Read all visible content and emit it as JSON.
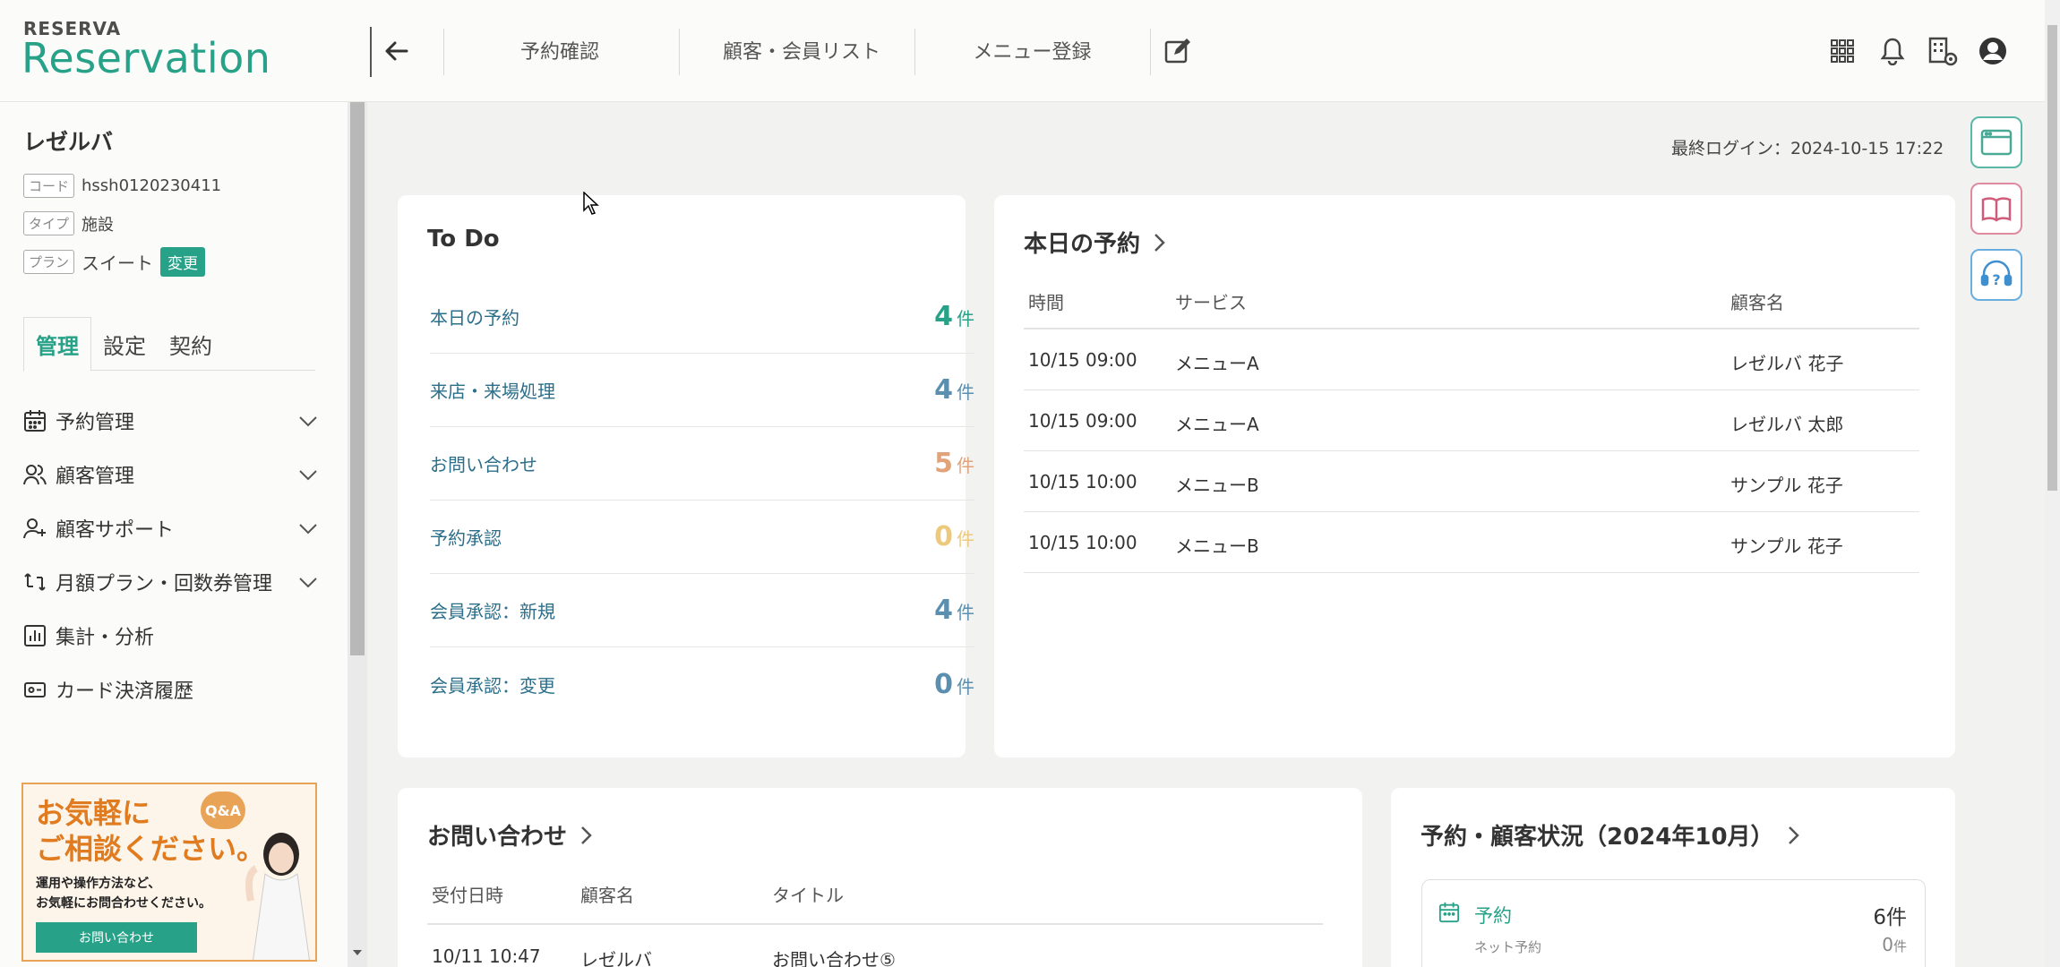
{
  "header": {
    "logo_small": "RESERVA",
    "logo_big": "Reservation",
    "nav": [
      "予約確認",
      "顧客・会員リスト",
      "メニュー登録"
    ]
  },
  "sidebar": {
    "shop_name": "レゼルバ",
    "code_label": "コード",
    "code_value": "hssh0120230411",
    "type_label": "タイプ",
    "type_value": "施設",
    "plan_label": "プラン",
    "plan_value": "スイート",
    "plan_change": "変更",
    "tabs": [
      "管理",
      "設定",
      "契約"
    ],
    "items": [
      {
        "label": "予約管理",
        "icon": "calendar-icon"
      },
      {
        "label": "顧客管理",
        "icon": "users-icon"
      },
      {
        "label": "顧客サポート",
        "icon": "user-plus-icon"
      },
      {
        "label": "月額プラン・回数券管理",
        "icon": "repeat-icon"
      },
      {
        "label": "集計・分析",
        "icon": "chart-icon"
      },
      {
        "label": "カード決済履歴",
        "icon": "card-icon"
      }
    ],
    "banner": {
      "title1": "お気軽に",
      "title2": "ご相談ください。",
      "qa": "Q&A",
      "text1": "運用や操作方法など、",
      "text2": "お気軽にお問合わせください。",
      "button": "お問い合わせ"
    }
  },
  "main": {
    "last_login": "最終ログイン：2024-10-15 17:22",
    "todo": {
      "title": "To Do",
      "unit": "件",
      "items": [
        {
          "label": "本日の予約",
          "count": "4",
          "color": "#27a288"
        },
        {
          "label": "来店・来場処理",
          "count": "4",
          "color": "#5b8fb0"
        },
        {
          "label": "お問い合わせ",
          "count": "5",
          "color": "#e0a37a"
        },
        {
          "label": "予約承認",
          "count": "0",
          "color": "#ecc97c"
        },
        {
          "label": "会員承認：新規",
          "count": "4",
          "color": "#5b8fb0"
        },
        {
          "label": "会員承認：変更",
          "count": "0",
          "color": "#5b8fb0"
        }
      ]
    },
    "today": {
      "title": "本日の予約",
      "headers": [
        "時間",
        "サービス",
        "顧客名"
      ],
      "rows": [
        [
          "10/15 09:00",
          "メニューA",
          "レゼルバ 花子"
        ],
        [
          "10/15 09:00",
          "メニューA",
          "レゼルバ 太郎"
        ],
        [
          "10/15 10:00",
          "メニューB",
          "サンプル 花子"
        ],
        [
          "10/15 10:00",
          "メニューB",
          "サンプル 花子"
        ]
      ]
    },
    "inquiry": {
      "title": "お問い合わせ",
      "headers": [
        "受付日時",
        "顧客名",
        "タイトル"
      ],
      "rows": [
        [
          "10/11 10:47",
          "レゼルバ",
          "お問い合わせ⑤"
        ]
      ]
    },
    "status": {
      "title": "予約・顧客状況（2024年10月）",
      "label": "予約",
      "count": "6件",
      "sub_label": "ネット予約",
      "sub_count": "0",
      "sub_unit": "件"
    }
  }
}
